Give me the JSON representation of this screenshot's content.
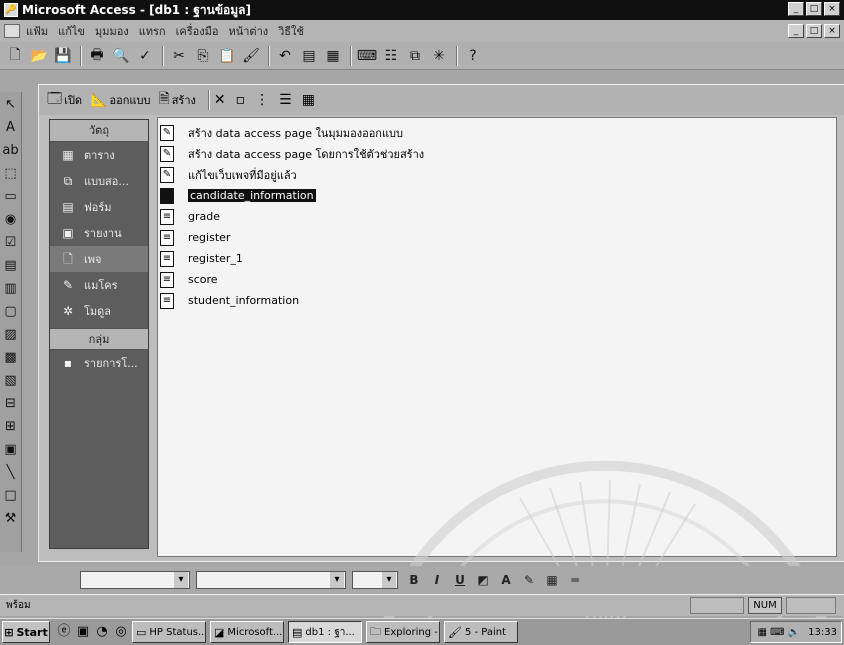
{
  "window": {
    "title": "Microsoft Access - [db1 : ฐานข้อมูล]",
    "min_glyph": "_",
    "max_glyph": "□",
    "close_glyph": "×"
  },
  "menubar": {
    "items": [
      "แฟ้ม",
      "แก้ไข",
      "มุมมอง",
      "แทรก",
      "เครื่องมือ",
      "หน้าต่าง",
      "วิธีใช้"
    ]
  },
  "db_toolbar": {
    "open_label": "เปิด",
    "design_label": "ออกแบบ",
    "new_label": "สร้าง"
  },
  "objects_bar": {
    "header": "วัตถุ",
    "items": [
      {
        "label": "ตาราง",
        "icon": "table-icon"
      },
      {
        "label": "แบบสอ...",
        "icon": "query-icon"
      },
      {
        "label": "ฟอร์ม",
        "icon": "form-icon"
      },
      {
        "label": "รายงาน",
        "icon": "report-icon"
      },
      {
        "label": "เพจ",
        "icon": "page-icon"
      },
      {
        "label": "แมโคร",
        "icon": "macro-icon"
      },
      {
        "label": "โมดูล",
        "icon": "module-icon"
      }
    ],
    "groups_header": "กลุ่ม",
    "groups": [
      {
        "label": "รายการโ...",
        "icon": "favorites-icon"
      }
    ]
  },
  "page_list": [
    {
      "label": "สร้าง data access page ในมุมมองออกแบบ",
      "kind": "command"
    },
    {
      "label": "สร้าง data access page โดยการใช้ตัวช่วยสร้าง",
      "kind": "command"
    },
    {
      "label": "แก้ไขเว็บเพจที่มีอยู่แล้ว",
      "kind": "command"
    },
    {
      "label": "candidate_information",
      "kind": "page",
      "selected": true
    },
    {
      "label": "grade",
      "kind": "page"
    },
    {
      "label": "register",
      "kind": "page"
    },
    {
      "label": "register_1",
      "kind": "page"
    },
    {
      "label": "score",
      "kind": "page"
    },
    {
      "label": "student_information",
      "kind": "page"
    }
  ],
  "format_bar": {
    "bold": "B",
    "italic": "I",
    "underline": "U"
  },
  "status": {
    "text": "พร้อม",
    "num": "NUM"
  },
  "taskbar": {
    "start_label": "Start",
    "tasks": [
      {
        "label": "HP Status..."
      },
      {
        "label": "Microsoft..."
      },
      {
        "label": "db1 : ฐา..."
      },
      {
        "label": "Exploring -"
      },
      {
        "label": "5 - Paint"
      }
    ],
    "clock": "13:33"
  }
}
